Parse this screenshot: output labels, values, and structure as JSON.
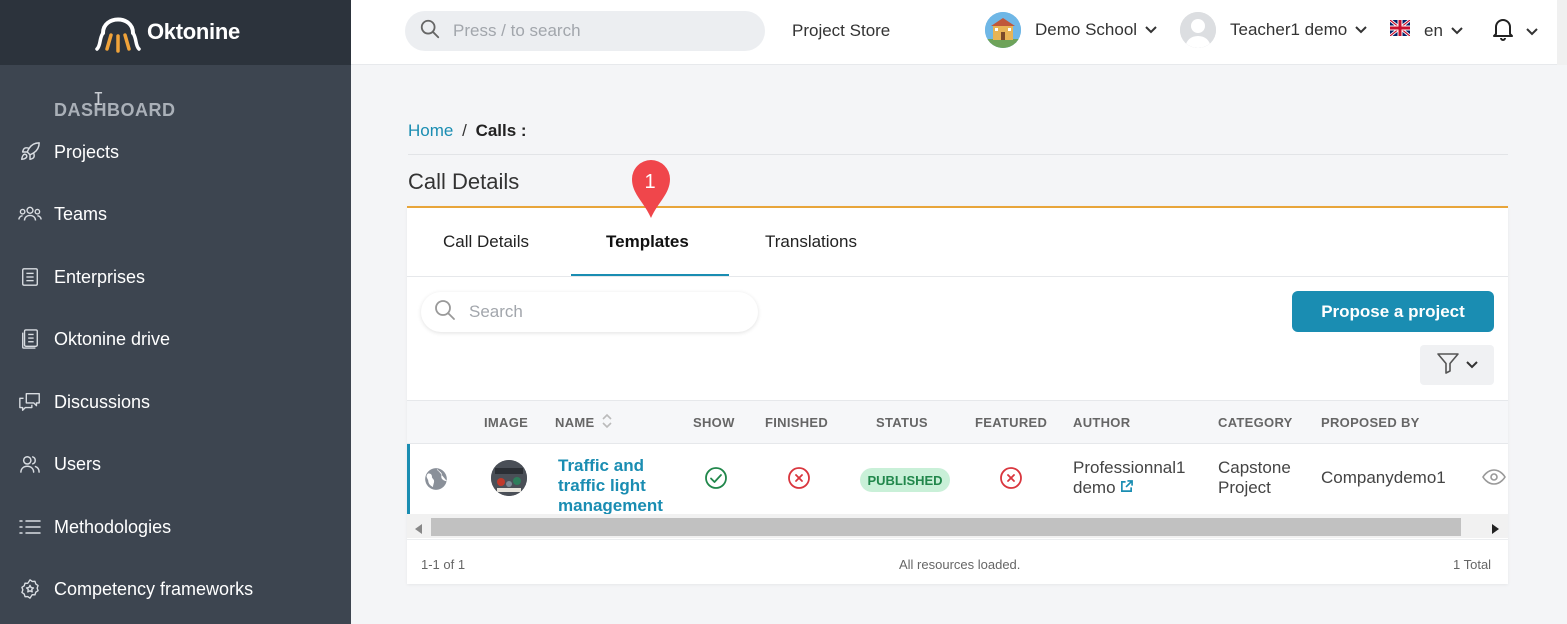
{
  "brand": {
    "name": "Oktonine"
  },
  "sidebar": {
    "heading": "DASHBOARD",
    "items": [
      {
        "label": "Projects",
        "icon": "rocket-icon"
      },
      {
        "label": "Teams",
        "icon": "team-icon"
      },
      {
        "label": "Enterprises",
        "icon": "enterprise-icon"
      },
      {
        "label": "Oktonine drive",
        "icon": "drive-icon"
      },
      {
        "label": "Discussions",
        "icon": "discussion-icon"
      },
      {
        "label": "Users",
        "icon": "users-icon"
      },
      {
        "label": "Methodologies",
        "icon": "list-icon"
      },
      {
        "label": "Competency frameworks",
        "icon": "badge-icon"
      }
    ]
  },
  "header": {
    "search_placeholder": "Press / to search",
    "store_link": "Project Store",
    "school_name": "Demo School",
    "user_name": "Teacher1 demo",
    "language": "en"
  },
  "breadcrumb": {
    "home": "Home",
    "separator": "/",
    "current": "Calls :"
  },
  "page_title": "Call Details",
  "marker_label": "1",
  "tabs": [
    {
      "label": "Call Details",
      "active": false
    },
    {
      "label": "Templates",
      "active": true
    },
    {
      "label": "Translations",
      "active": false
    }
  ],
  "toolbar": {
    "search_placeholder": "Search",
    "propose_label": "Propose a project"
  },
  "table": {
    "columns": [
      "IMAGE",
      "NAME",
      "SHOW",
      "FINISHED",
      "STATUS",
      "FEATURED",
      "AUTHOR",
      "CATEGORY",
      "PROPOSED BY"
    ],
    "rows": [
      {
        "name_line1": "Traffic and",
        "name_line2": "traffic light",
        "name_line3": "management",
        "show": "check",
        "finished": "cross",
        "status": "PUBLISHED",
        "featured": "cross",
        "author_line1": "Professionnal1",
        "author_line2": "demo",
        "category_line1": "Capstone",
        "category_line2": "Project",
        "proposed_by": "Companydemo1"
      }
    ]
  },
  "footer": {
    "range": "1-1 of 1",
    "status": "All resources loaded.",
    "total": "1 Total"
  },
  "colors": {
    "sidebar": "#3d4550",
    "sidebar_top": "#2c333c",
    "accent": "#1a8db2",
    "tab_border": "#e8a53a",
    "marker": "#f0464b",
    "success": "#21874b",
    "danger": "#d9363e"
  }
}
